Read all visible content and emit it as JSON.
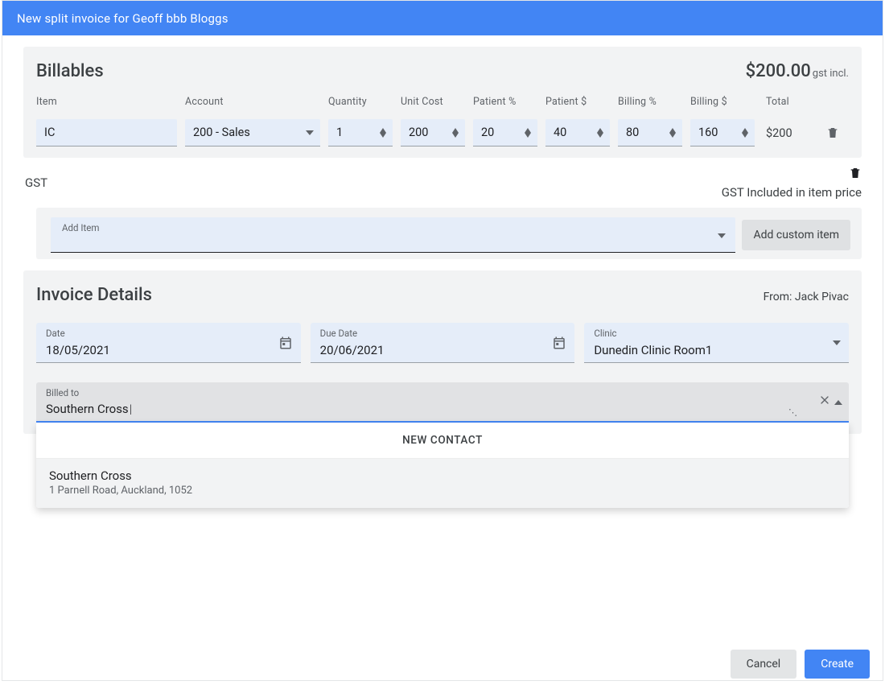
{
  "title": "New split invoice for Geoff bbb Bloggs",
  "billables": {
    "heading": "Billables",
    "total": "$200.00",
    "gst_suffix": "gst incl.",
    "columns": {
      "item": "Item",
      "account": "Account",
      "quantity": "Quantity",
      "unit_cost": "Unit Cost",
      "patient_pct": "Patient %",
      "patient_amt": "Patient $",
      "billing_pct": "Billing %",
      "billing_amt": "Billing $",
      "total": "Total"
    },
    "row": {
      "item": "IC",
      "account": "200 - Sales",
      "quantity": "1",
      "unit_cost": "200",
      "patient_pct": "20",
      "patient_amt": "40",
      "billing_pct": "80",
      "billing_amt": "160",
      "total": "$200"
    }
  },
  "gst": {
    "label": "GST",
    "note": "GST Included in item price"
  },
  "add_item": {
    "label": "Add Item",
    "custom": "Add custom item"
  },
  "invoice": {
    "heading": "Invoice Details",
    "from_label": "From: ",
    "from_name": "Jack Pivac",
    "date_label": "Date",
    "date_value": "18/05/2021",
    "due_label": "Due Date",
    "due_value": "20/06/2021",
    "clinic_label": "Clinic",
    "clinic_value": "Dunedin Clinic Room1",
    "billed_label": "Billed to",
    "billed_value": "Southern Cross"
  },
  "autocomplete": {
    "new_contact": "NEW CONTACT",
    "items": [
      {
        "name": "Southern Cross",
        "address": "1 Parnell Road, Auckland, 1052"
      }
    ]
  },
  "buttons": {
    "cancel": "Cancel",
    "create": "Create"
  }
}
